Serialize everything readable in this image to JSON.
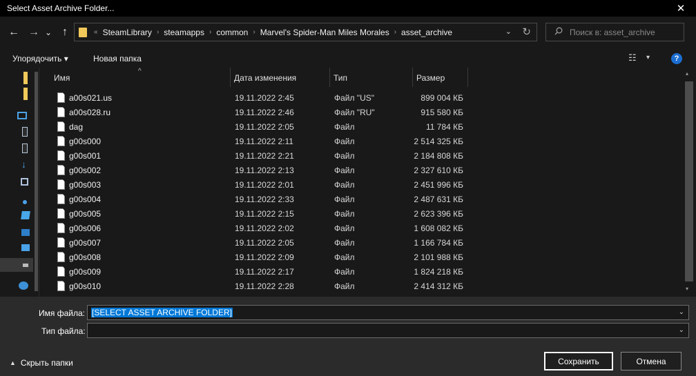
{
  "window": {
    "title": "Select Asset Archive Folder...",
    "close_glyph": "✕"
  },
  "nav": {
    "back_glyph": "←",
    "forward_glyph": "→",
    "recent_glyph": "⌄",
    "up_glyph": "↑"
  },
  "address": {
    "overflow": "«",
    "segments": [
      "SteamLibrary",
      "steamapps",
      "common",
      "Marvel's Spider-Man Miles Morales",
      "asset_archive"
    ],
    "separator": "›",
    "dropdown_glyph": "⌄",
    "refresh_glyph": "↻"
  },
  "search": {
    "placeholder": "Поиск в: asset_archive"
  },
  "toolbar": {
    "organize_label": "Упорядочить ▾",
    "new_folder_label": "Новая папка",
    "view_glyph": "☷",
    "view_dropdown_glyph": "▾",
    "help_glyph": "?"
  },
  "columns": {
    "name": "Имя",
    "date": "Дата изменения",
    "type": "Тип",
    "size": "Размер",
    "sort_indicator": "^"
  },
  "files": [
    {
      "name": "a00s021.us",
      "date": "19.11.2022 2:45",
      "type": "Файл \"US\"",
      "size": "899 004 КБ"
    },
    {
      "name": "a00s028.ru",
      "date": "19.11.2022 2:46",
      "type": "Файл \"RU\"",
      "size": "915 580 КБ"
    },
    {
      "name": "dag",
      "date": "19.11.2022 2:05",
      "type": "Файл",
      "size": "11 784 КБ"
    },
    {
      "name": "g00s000",
      "date": "19.11.2022 2:11",
      "type": "Файл",
      "size": "2 514 325 КБ"
    },
    {
      "name": "g00s001",
      "date": "19.11.2022 2:21",
      "type": "Файл",
      "size": "2 184 808 КБ"
    },
    {
      "name": "g00s002",
      "date": "19.11.2022 2:13",
      "type": "Файл",
      "size": "2 327 610 КБ"
    },
    {
      "name": "g00s003",
      "date": "19.11.2022 2:01",
      "type": "Файл",
      "size": "2 451 996 КБ"
    },
    {
      "name": "g00s004",
      "date": "19.11.2022 2:33",
      "type": "Файл",
      "size": "2 487 631 КБ"
    },
    {
      "name": "g00s005",
      "date": "19.11.2022 2:15",
      "type": "Файл",
      "size": "2 623 396 КБ"
    },
    {
      "name": "g00s006",
      "date": "19.11.2022 2:02",
      "type": "Файл",
      "size": "1 608 082 КБ"
    },
    {
      "name": "g00s007",
      "date": "19.11.2022 2:05",
      "type": "Файл",
      "size": "1 166 784 КБ"
    },
    {
      "name": "g00s008",
      "date": "19.11.2022 2:09",
      "type": "Файл",
      "size": "2 101 988 КБ"
    },
    {
      "name": "g00s009",
      "date": "19.11.2022 2:17",
      "type": "Файл",
      "size": "1 824 218 КБ"
    },
    {
      "name": "g00s010",
      "date": "19.11.2022 2:28",
      "type": "Файл",
      "size": "2 414 312 КБ"
    }
  ],
  "filename": {
    "label": "Имя файла:",
    "value": "[SELECT ASSET ARCHIVE FOLDER]",
    "dropdown_glyph": "⌄"
  },
  "filetype": {
    "label": "Тип файла:",
    "value": "",
    "dropdown_glyph": "⌄"
  },
  "footer": {
    "hide_folders_label": "Скрыть папки",
    "hide_folders_glyph": "▲",
    "save_label": "Сохранить",
    "cancel_label": "Отмена"
  },
  "sidebar": {
    "scroll_up_glyph": "▴",
    "scroll_down_glyph": "▾"
  },
  "colors": {
    "background": "#191919",
    "selection": "#0078d7",
    "folder": "#f0c95a",
    "bottom_panel": "#2b2b2b"
  }
}
